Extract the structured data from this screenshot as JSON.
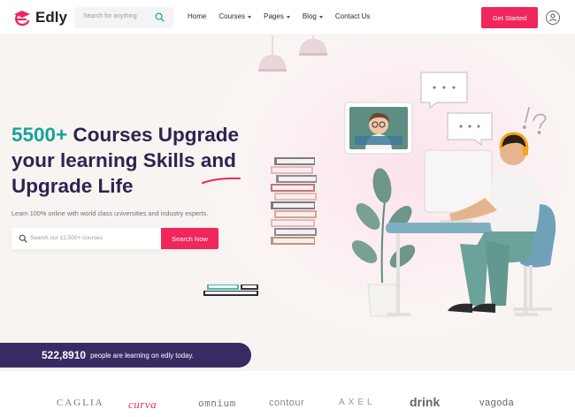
{
  "header": {
    "logo_text": "Edly",
    "search_placeholder": "Search for anything",
    "nav": [
      {
        "label": "Home",
        "dropdown": false
      },
      {
        "label": "Courses",
        "dropdown": true
      },
      {
        "label": "Pages",
        "dropdown": true
      },
      {
        "label": "Blog",
        "dropdown": true
      },
      {
        "label": "Contact Us",
        "dropdown": false
      }
    ],
    "cta_label": "Get Started"
  },
  "hero": {
    "headline_accent": "5500+",
    "headline_rest_1": " Courses Upgrade",
    "headline_line_2": "your learning Skills and",
    "headline_line_3": "Upgrade Life",
    "subtitle": "Learn 100% online with world class universities and industry experts.",
    "search_placeholder": "Search our 12,500+ courses",
    "search_button": "Search Now"
  },
  "stats": {
    "number": "522,8910",
    "text": "people are learning on edly today."
  },
  "partners": [
    "CAGLIA",
    "curva",
    "omnium",
    "contour",
    "AXEL",
    "drink",
    "vagoda"
  ],
  "colors": {
    "primary": "#f0265c",
    "accent": "#14a39a",
    "navy": "#2d2351",
    "stats_bg": "#3a2a63"
  }
}
